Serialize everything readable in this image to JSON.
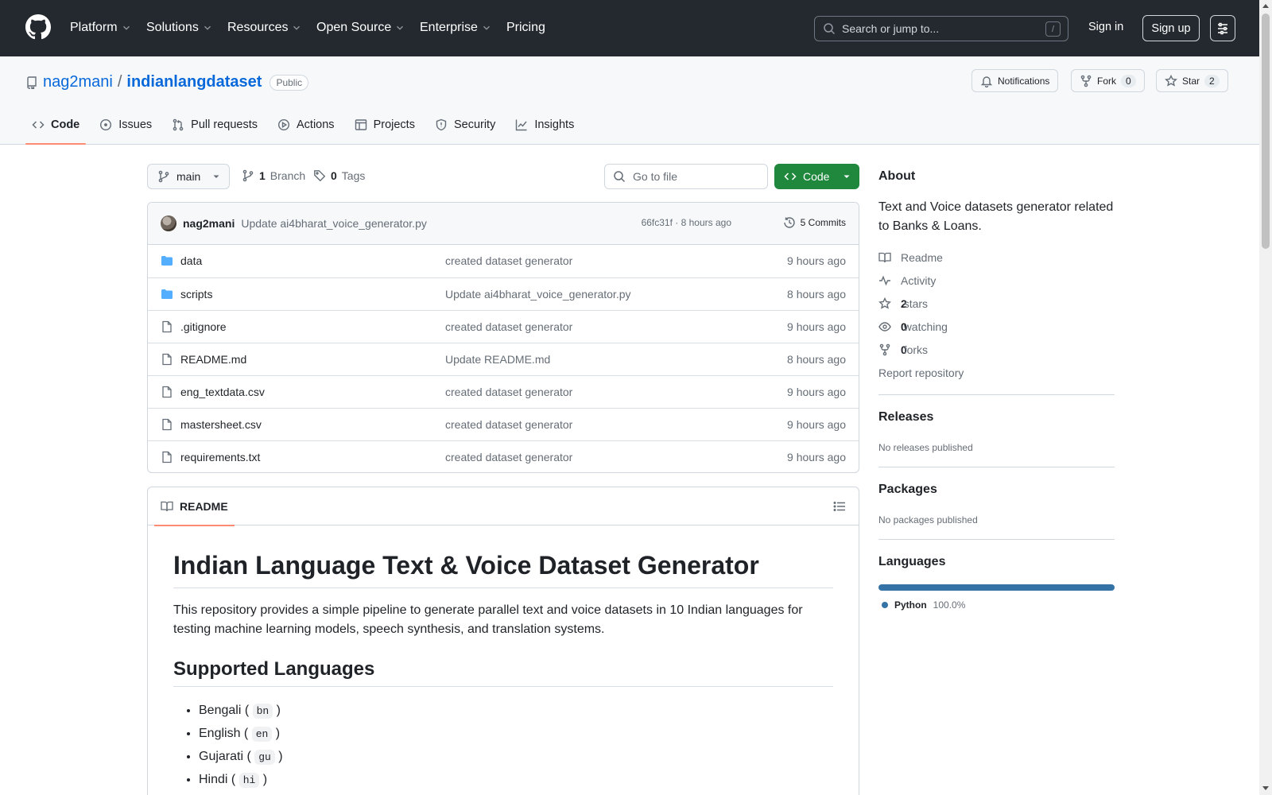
{
  "header": {
    "nav": [
      "Platform",
      "Solutions",
      "Resources",
      "Open Source",
      "Enterprise",
      "Pricing"
    ],
    "search_placeholder": "Search or jump to...",
    "search_key": "/",
    "signin": "Sign in",
    "signup": "Sign up"
  },
  "repo": {
    "owner": "nag2mani",
    "separator": "/",
    "name": "indianlangdataset",
    "visibility": "Public",
    "notifications_label": "Notifications",
    "fork_label": "Fork",
    "fork_count": "0",
    "star_label": "Star",
    "star_count": "2",
    "tabs": [
      "Code",
      "Issues",
      "Pull requests",
      "Actions",
      "Projects",
      "Security",
      "Insights"
    ]
  },
  "toolbar": {
    "branch": "main",
    "branch_count": "1",
    "branch_label": "Branch",
    "tag_count": "0",
    "tag_label": "Tags",
    "goto_placeholder": "Go to file",
    "code_label": "Code"
  },
  "commit": {
    "author": "nag2mani",
    "message": "Update ai4bharat_voice_generator.py",
    "hash": "66fc31f",
    "time": "8 hours ago",
    "count_label": "5 Commits"
  },
  "files": [
    {
      "type": "folder",
      "name": "data",
      "message": "created dataset generator",
      "time": "9 hours ago"
    },
    {
      "type": "folder",
      "name": "scripts",
      "message": "Update ai4bharat_voice_generator.py",
      "time": "8 hours ago"
    },
    {
      "type": "file",
      "name": ".gitignore",
      "message": "created dataset generator",
      "time": "9 hours ago"
    },
    {
      "type": "file",
      "name": "README.md",
      "message": "Update README.md",
      "time": "8 hours ago"
    },
    {
      "type": "file",
      "name": "eng_textdata.csv",
      "message": "created dataset generator",
      "time": "9 hours ago"
    },
    {
      "type": "file",
      "name": "mastersheet.csv",
      "message": "created dataset generator",
      "time": "9 hours ago"
    },
    {
      "type": "file",
      "name": "requirements.txt",
      "message": "created dataset generator",
      "time": "9 hours ago"
    }
  ],
  "readme": {
    "tab_label": "README",
    "h1": "Indian Language Text & Voice Dataset Generator",
    "intro": "This repository provides a simple pipeline to generate parallel text and voice datasets in 10 Indian languages for testing machine learning models, speech synthesis, and translation systems.",
    "h2": "Supported Languages",
    "languages": [
      {
        "name": "Bengali",
        "code": "bn"
      },
      {
        "name": "English",
        "code": "en"
      },
      {
        "name": "Gujarati",
        "code": "gu"
      },
      {
        "name": "Hindi",
        "code": "hi"
      }
    ]
  },
  "sidebar": {
    "about_title": "About",
    "description": "Text and Voice datasets generator related to Banks & Loans.",
    "links": {
      "readme": "Readme",
      "activity": "Activity",
      "stars_count": "2",
      "stars_label": "stars",
      "watching_count": "0",
      "watching_label": "watching",
      "forks_count": "0",
      "forks_label": "forks",
      "report": "Report repository"
    },
    "releases_title": "Releases",
    "releases_note": "No releases published",
    "packages_title": "Packages",
    "packages_note": "No packages published",
    "languages_title": "Languages",
    "languages": [
      {
        "name": "Python",
        "percent_label": "100.0%",
        "percent": 100,
        "color": "#3572A5"
      }
    ]
  },
  "colors": {
    "header_bg": "#24292f",
    "link": "#0969da",
    "primary_button": "#1f883d",
    "tab_underline": "#fd8c73",
    "folder": "#54aeff"
  }
}
